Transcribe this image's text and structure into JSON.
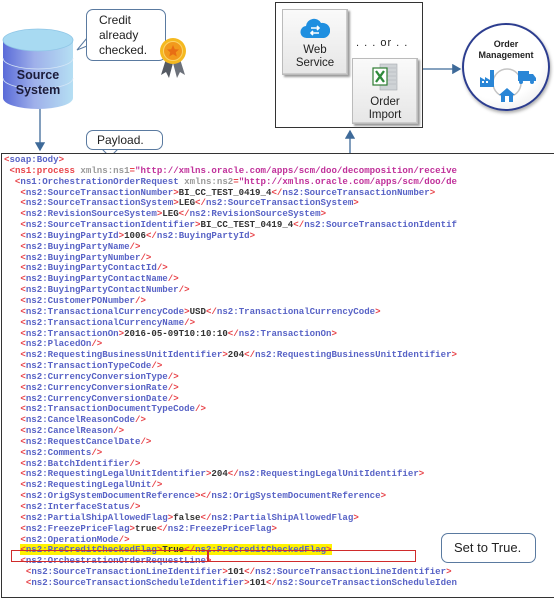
{
  "source_system": {
    "label_line1": "Source",
    "label_line2": "System"
  },
  "credit_callout": {
    "line1": "Credit",
    "line2": "already",
    "line3": "checked."
  },
  "payload_callout": {
    "text": "Payload."
  },
  "channels": {
    "web_service": {
      "line1": "Web",
      "line2": "Service",
      "icon": "cloud-sync-icon"
    },
    "or_text": ". . . or . .",
    "order_import": {
      "line1": "Order",
      "line2": "Import",
      "icon": "excel-icon"
    }
  },
  "order_management": {
    "line1": "Order",
    "line2": "Management",
    "icons": [
      "factory-icon",
      "truck-icon",
      "home-icon"
    ]
  },
  "true_callout": {
    "text": "Set to True."
  },
  "colors": {
    "tag_bracket": "#e8454b",
    "tag_name": "#5863c6",
    "attr_value": "#c0309a",
    "highlight": "#fff200",
    "highlight_border": "#d02b2b",
    "om_ring": "#2c3d8f"
  },
  "xml": [
    {
      "indent": 0,
      "parts": [
        [
          "t",
          "<"
        ],
        [
          "n",
          "soap:Body"
        ],
        [
          "t",
          ">"
        ]
      ]
    },
    {
      "indent": 1,
      "parts": [
        [
          "t",
          "<"
        ],
        [
          "t",
          "ns1:process"
        ],
        [
          "a",
          " xmlns:ns1"
        ],
        [
          "t",
          "="
        ],
        [
          "s",
          "\"http://xmlns.oracle.com/apps/scm/doo/decomposition/receive"
        ]
      ]
    },
    {
      "indent": 2,
      "parts": [
        [
          "t",
          "<"
        ],
        [
          "n",
          "ns1:OrchestrationOrderRequest"
        ],
        [
          "a",
          " xmlns:ns2"
        ],
        [
          "t",
          "="
        ],
        [
          "s",
          "\"http://xmlns.oracle.com/apps/scm/doo/de"
        ]
      ]
    },
    {
      "indent": 3,
      "parts": [
        [
          "t",
          "<"
        ],
        [
          "n",
          "ns2:SourceTransactionNumber"
        ],
        [
          "t",
          ">"
        ],
        [
          "v",
          "BI_CC_TEST_0419_4"
        ],
        [
          "t",
          "</"
        ],
        [
          "n",
          "ns2:SourceTransactionNumber"
        ],
        [
          "t",
          ">"
        ]
      ]
    },
    {
      "indent": 3,
      "parts": [
        [
          "t",
          "<"
        ],
        [
          "n",
          "ns2:SourceTransactionSystem"
        ],
        [
          "t",
          ">"
        ],
        [
          "v",
          "LEG"
        ],
        [
          "t",
          "</"
        ],
        [
          "n",
          "ns2:SourceTransactionSystem"
        ],
        [
          "t",
          ">"
        ]
      ]
    },
    {
      "indent": 3,
      "parts": [
        [
          "t",
          "<"
        ],
        [
          "n",
          "ns2:RevisionSourceSystem"
        ],
        [
          "t",
          ">"
        ],
        [
          "v",
          "LEG"
        ],
        [
          "t",
          "</"
        ],
        [
          "n",
          "ns2:RevisionSourceSystem"
        ],
        [
          "t",
          ">"
        ]
      ]
    },
    {
      "indent": 3,
      "parts": [
        [
          "t",
          "<"
        ],
        [
          "n",
          "ns2:SourceTransactionIdentifier"
        ],
        [
          "t",
          ">"
        ],
        [
          "v",
          "BI_CC_TEST_0419_4"
        ],
        [
          "t",
          "</"
        ],
        [
          "n",
          "ns2:SourceTransactionIdentif"
        ]
      ]
    },
    {
      "indent": 3,
      "parts": [
        [
          "t",
          "<"
        ],
        [
          "n",
          "ns2:BuyingPartyId"
        ],
        [
          "t",
          ">"
        ],
        [
          "v",
          "1006"
        ],
        [
          "t",
          "</"
        ],
        [
          "n",
          "ns2:BuyingPartyId"
        ],
        [
          "t",
          ">"
        ]
      ]
    },
    {
      "indent": 3,
      "parts": [
        [
          "t",
          "<"
        ],
        [
          "n",
          "ns2:BuyingPartyName"
        ],
        [
          "t",
          "/>"
        ]
      ]
    },
    {
      "indent": 3,
      "parts": [
        [
          "t",
          "<"
        ],
        [
          "n",
          "ns2:BuyingPartyNumber"
        ],
        [
          "t",
          "/>"
        ]
      ]
    },
    {
      "indent": 3,
      "parts": [
        [
          "t",
          "<"
        ],
        [
          "n",
          "ns2:BuyingPartyContactId"
        ],
        [
          "t",
          "/>"
        ]
      ]
    },
    {
      "indent": 3,
      "parts": [
        [
          "t",
          "<"
        ],
        [
          "n",
          "ns2:BuyingPartyContactName"
        ],
        [
          "t",
          "/>"
        ]
      ]
    },
    {
      "indent": 3,
      "parts": [
        [
          "t",
          "<"
        ],
        [
          "n",
          "ns2:BuyingPartyContactNumber"
        ],
        [
          "t",
          "/>"
        ]
      ]
    },
    {
      "indent": 3,
      "parts": [
        [
          "t",
          "<"
        ],
        [
          "n",
          "ns2:CustomerPONumber"
        ],
        [
          "t",
          "/>"
        ]
      ]
    },
    {
      "indent": 3,
      "parts": [
        [
          "t",
          "<"
        ],
        [
          "n",
          "ns2:TransactionalCurrencyCode"
        ],
        [
          "t",
          ">"
        ],
        [
          "v",
          "USD"
        ],
        [
          "t",
          "</"
        ],
        [
          "n",
          "ns2:TransactionalCurrencyCode"
        ],
        [
          "t",
          ">"
        ]
      ]
    },
    {
      "indent": 3,
      "parts": [
        [
          "t",
          "<"
        ],
        [
          "n",
          "ns2:TransactionalCurrencyName"
        ],
        [
          "t",
          "/>"
        ]
      ]
    },
    {
      "indent": 3,
      "parts": [
        [
          "t",
          "<"
        ],
        [
          "n",
          "ns2:TransactionOn"
        ],
        [
          "t",
          ">"
        ],
        [
          "v",
          "2016-05-09T10:10:10"
        ],
        [
          "t",
          "</"
        ],
        [
          "n",
          "ns2:TransactionOn"
        ],
        [
          "t",
          ">"
        ]
      ]
    },
    {
      "indent": 3,
      "parts": [
        [
          "t",
          "<"
        ],
        [
          "n",
          "ns2:PlacedOn"
        ],
        [
          "t",
          "/>"
        ]
      ]
    },
    {
      "indent": 3,
      "parts": [
        [
          "t",
          "<"
        ],
        [
          "n",
          "ns2:RequestingBusinessUnitIdentifier"
        ],
        [
          "t",
          ">"
        ],
        [
          "v",
          "204"
        ],
        [
          "t",
          "</"
        ],
        [
          "n",
          "ns2:RequestingBusinessUnitIdentifier"
        ],
        [
          "t",
          ">"
        ]
      ]
    },
    {
      "indent": 3,
      "parts": [
        [
          "t",
          "<"
        ],
        [
          "n",
          "ns2:TransactionTypeCode"
        ],
        [
          "t",
          "/>"
        ]
      ]
    },
    {
      "indent": 3,
      "parts": [
        [
          "t",
          "<"
        ],
        [
          "n",
          "ns2:CurrencyConversionType"
        ],
        [
          "t",
          "/>"
        ]
      ]
    },
    {
      "indent": 3,
      "parts": [
        [
          "t",
          "<"
        ],
        [
          "n",
          "ns2:CurrencyConversionRate"
        ],
        [
          "t",
          "/>"
        ]
      ]
    },
    {
      "indent": 3,
      "parts": [
        [
          "t",
          "<"
        ],
        [
          "n",
          "ns2:CurrencyConversionDate"
        ],
        [
          "t",
          "/>"
        ]
      ]
    },
    {
      "indent": 3,
      "parts": [
        [
          "t",
          "<"
        ],
        [
          "n",
          "ns2:TransactionDocumentTypeCode"
        ],
        [
          "t",
          "/>"
        ]
      ]
    },
    {
      "indent": 3,
      "parts": [
        [
          "t",
          "<"
        ],
        [
          "n",
          "ns2:CancelReasonCode"
        ],
        [
          "t",
          "/>"
        ]
      ]
    },
    {
      "indent": 3,
      "parts": [
        [
          "t",
          "<"
        ],
        [
          "n",
          "ns2:CancelReason"
        ],
        [
          "t",
          "/>"
        ]
      ]
    },
    {
      "indent": 3,
      "parts": [
        [
          "t",
          "<"
        ],
        [
          "n",
          "ns2:RequestCancelDate"
        ],
        [
          "t",
          "/>"
        ]
      ]
    },
    {
      "indent": 3,
      "parts": [
        [
          "t",
          "<"
        ],
        [
          "n",
          "ns2:Comments"
        ],
        [
          "t",
          "/>"
        ]
      ]
    },
    {
      "indent": 3,
      "parts": [
        [
          "t",
          "<"
        ],
        [
          "n",
          "ns2:BatchIdentifier"
        ],
        [
          "t",
          "/>"
        ]
      ]
    },
    {
      "indent": 3,
      "parts": [
        [
          "t",
          "<"
        ],
        [
          "n",
          "ns2:RequestingLegalUnitIdentifier"
        ],
        [
          "t",
          ">"
        ],
        [
          "v",
          "204"
        ],
        [
          "t",
          "</"
        ],
        [
          "n",
          "ns2:RequestingLegalUnitIdentifier"
        ],
        [
          "t",
          ">"
        ]
      ]
    },
    {
      "indent": 3,
      "parts": [
        [
          "t",
          "<"
        ],
        [
          "n",
          "ns2:RequestingLegalUnit"
        ],
        [
          "t",
          "/>"
        ]
      ]
    },
    {
      "indent": 3,
      "parts": [
        [
          "t",
          "<"
        ],
        [
          "n",
          "ns2:OrigSystemDocumentReference"
        ],
        [
          "t",
          "></"
        ],
        [
          "n",
          "ns2:OrigSystemDocumentReference"
        ],
        [
          "t",
          ">"
        ]
      ]
    },
    {
      "indent": 3,
      "parts": [
        [
          "t",
          "<"
        ],
        [
          "n",
          "ns2:InterfaceStatus"
        ],
        [
          "t",
          "/>"
        ]
      ]
    },
    {
      "indent": 3,
      "parts": [
        [
          "t",
          "<"
        ],
        [
          "n",
          "ns2:PartialShipAllowedFlag"
        ],
        [
          "t",
          ">"
        ],
        [
          "v",
          "false"
        ],
        [
          "t",
          "</"
        ],
        [
          "n",
          "ns2:PartialShipAllowedFlag"
        ],
        [
          "t",
          ">"
        ]
      ]
    },
    {
      "indent": 3,
      "parts": [
        [
          "t",
          "<"
        ],
        [
          "n",
          "ns2:FreezePriceFlag"
        ],
        [
          "t",
          ">"
        ],
        [
          "v",
          "true"
        ],
        [
          "t",
          "</"
        ],
        [
          "n",
          "ns2:FreezePriceFlag"
        ],
        [
          "t",
          ">"
        ]
      ]
    },
    {
      "indent": 3,
      "parts": [
        [
          "t",
          "<"
        ],
        [
          "n",
          "ns2:OperationMode"
        ],
        [
          "t",
          "/>"
        ]
      ]
    },
    {
      "indent": 3,
      "highlight": true,
      "parts": [
        [
          "t",
          "<"
        ],
        [
          "n",
          "ns2:PreCreditCheckedFlag"
        ],
        [
          "t",
          ">"
        ],
        [
          "v",
          "True"
        ],
        [
          "t",
          "</"
        ],
        [
          "n",
          "ns2:PreCreditCheckedFlag"
        ],
        [
          "t",
          ">"
        ]
      ]
    },
    {
      "indent": 3,
      "parts": [
        [
          "t",
          "<"
        ],
        [
          "n",
          "ns2:OrchestrationOrderRequestLine"
        ],
        [
          "t",
          ">"
        ]
      ]
    },
    {
      "indent": 4,
      "parts": [
        [
          "t",
          "<"
        ],
        [
          "n",
          "ns2:SourceTransactionLineIdentifier"
        ],
        [
          "t",
          ">"
        ],
        [
          "v",
          "101"
        ],
        [
          "t",
          "</"
        ],
        [
          "n",
          "ns2:SourceTransactionLineIdentifier"
        ],
        [
          "t",
          ">"
        ]
      ]
    },
    {
      "indent": 4,
      "parts": [
        [
          "t",
          "<"
        ],
        [
          "n",
          "ns2:SourceTransactionScheduleIdentifier"
        ],
        [
          "t",
          ">"
        ],
        [
          "v",
          "101"
        ],
        [
          "t",
          "</"
        ],
        [
          "n",
          "ns2:SourceTransactionScheduleIden"
        ]
      ]
    }
  ]
}
